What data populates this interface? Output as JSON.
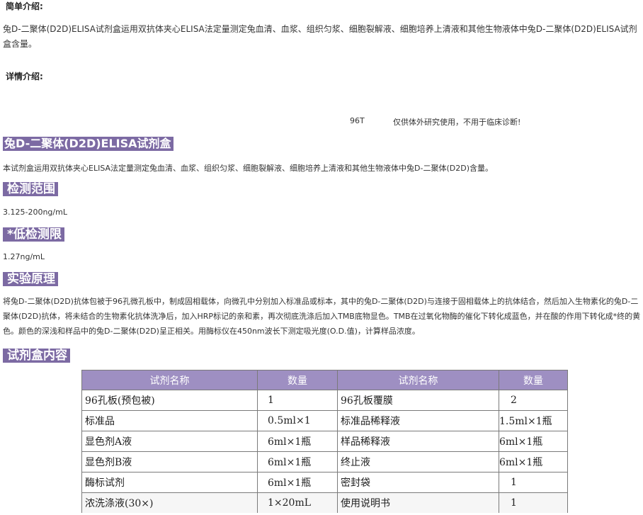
{
  "intro": {
    "heading": "简单介绍:",
    "text": "兔D-二聚体(D2D)ELISA试剂盒运用双抗体夹心ELISA法定量测定兔血清、血浆、组织匀浆、细胞裂解液、细胞培养上清液和其他生物液体中兔D-二聚体(D2D)ELISA试剂盒含量。"
  },
  "details": {
    "heading": "详情介绍:",
    "size": "96T",
    "notice": "仅供体外研究使用，不用于临床诊断!"
  },
  "product": {
    "title": "兔D-二聚体(D2D)ELISA试剂盒",
    "description": "本试剂盒运用双抗体夹心ELISA法定量测定兔血清、血浆、组织匀浆、细胞裂解液、细胞培养上清液和其他生物液体中兔D-二聚体(D2D)含量。"
  },
  "range": {
    "heading": "检测范围",
    "value": "3.125-200ng/mL"
  },
  "limit": {
    "heading": "*低检测限",
    "value": "1.27ng/mL"
  },
  "principle": {
    "heading": "实验原理",
    "text": "将兔D-二聚体(D2D)抗体包被于96孔微孔板中，制成固相载体，向微孔中分别加入标准品或标本，其中的兔D-二聚体(D2D)与连接于固相载体上的抗体结合，然后加入生物素化的兔D-二聚体(D2D)抗体，将未结合的生物素化抗体洗净后，加入HRP标记的亲和素，再次彻底洗涤后加入TMB底物显色。TMB在过氧化物酶的催化下转化成蓝色，并在酸的作用下转化成*终的黄色。颜色的深浅和样品中的兔D-二聚体(D2D)呈正相关。用酶标仪在450nm波长下测定吸光度(O.D.值)，计算样品浓度。"
  },
  "kit": {
    "heading": "试剂盒内容",
    "headers": [
      "试剂名称",
      "数量",
      "试剂名称",
      "数量"
    ],
    "rows": [
      [
        "96孔板(预包被)",
        "1",
        "96孔板覆膜",
        "2"
      ],
      [
        "标准品",
        "0.5ml×1",
        "标准品稀释液",
        "1.5ml×1瓶"
      ],
      [
        "显色剂A液",
        "6ml×1瓶",
        "样品稀释液",
        "6ml×1瓶"
      ],
      [
        "显色剂B液",
        "6ml×1瓶",
        "终止液",
        "6ml×1瓶"
      ],
      [
        "酶标试剂",
        "6ml×1瓶",
        "密封袋",
        "1"
      ],
      [
        "浓洗涤液(30×)",
        "1×20mL",
        "使用说明书",
        "1"
      ]
    ]
  },
  "colors": {
    "header_bg": "#7c6aa3",
    "table_header_bg": "#9e8fc2"
  }
}
